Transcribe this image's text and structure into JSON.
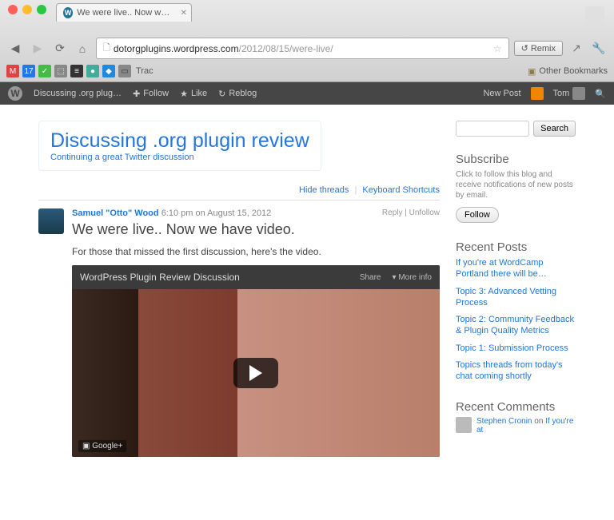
{
  "browser": {
    "tab_title": "We were live.. Now we have",
    "url_host": "dotorgplugins.wordpress.com",
    "url_path": "/2012/08/15/were-live/",
    "trac_label": "Trac",
    "remix_label": "Remix",
    "other_bookmarks": "Other Bookmarks"
  },
  "adminbar": {
    "site_name": "Discussing .org plug…",
    "follow": "Follow",
    "like": "Like",
    "reblog": "Reblog",
    "new_post": "New Post",
    "user": "Tom"
  },
  "site": {
    "title": "Discussing .org plugin review",
    "tagline": "Continuing a great Twitter discussion"
  },
  "post_actions": {
    "hide_threads": "Hide threads",
    "keyboard": "Keyboard Shortcuts"
  },
  "post": {
    "author": "Samuel \"Otto\" Wood",
    "meta": "6:10 pm on August 15, 2012",
    "reply": "Reply",
    "unfollow": "Unfollow",
    "title": "We were live.. Now we have video.",
    "body": "For those that missed the first discussion, here's the video.",
    "video_title": "WordPress Plugin Review Discussion",
    "share": "Share",
    "more_info": "More info",
    "gplus": "Google+"
  },
  "sidebar": {
    "search_btn": "Search",
    "subscribe_heading": "Subscribe",
    "subscribe_desc": "Click to follow this blog and receive notifications of new posts by email.",
    "follow_btn": "Follow",
    "recent_posts_heading": "Recent Posts",
    "recent_posts": [
      "If you're at WordCamp Portland there will be…",
      "Topic 3: Advanced Vetting Process",
      "Topic 2: Community Feedback & Plugin Quality Metrics",
      "Topic 1: Submission Process",
      "Topics threads from today's chat coming shortly"
    ],
    "recent_comments_heading": "Recent Comments",
    "comment_author": "Stephen Cronin",
    "comment_on": " on ",
    "comment_post": "If you're at"
  }
}
